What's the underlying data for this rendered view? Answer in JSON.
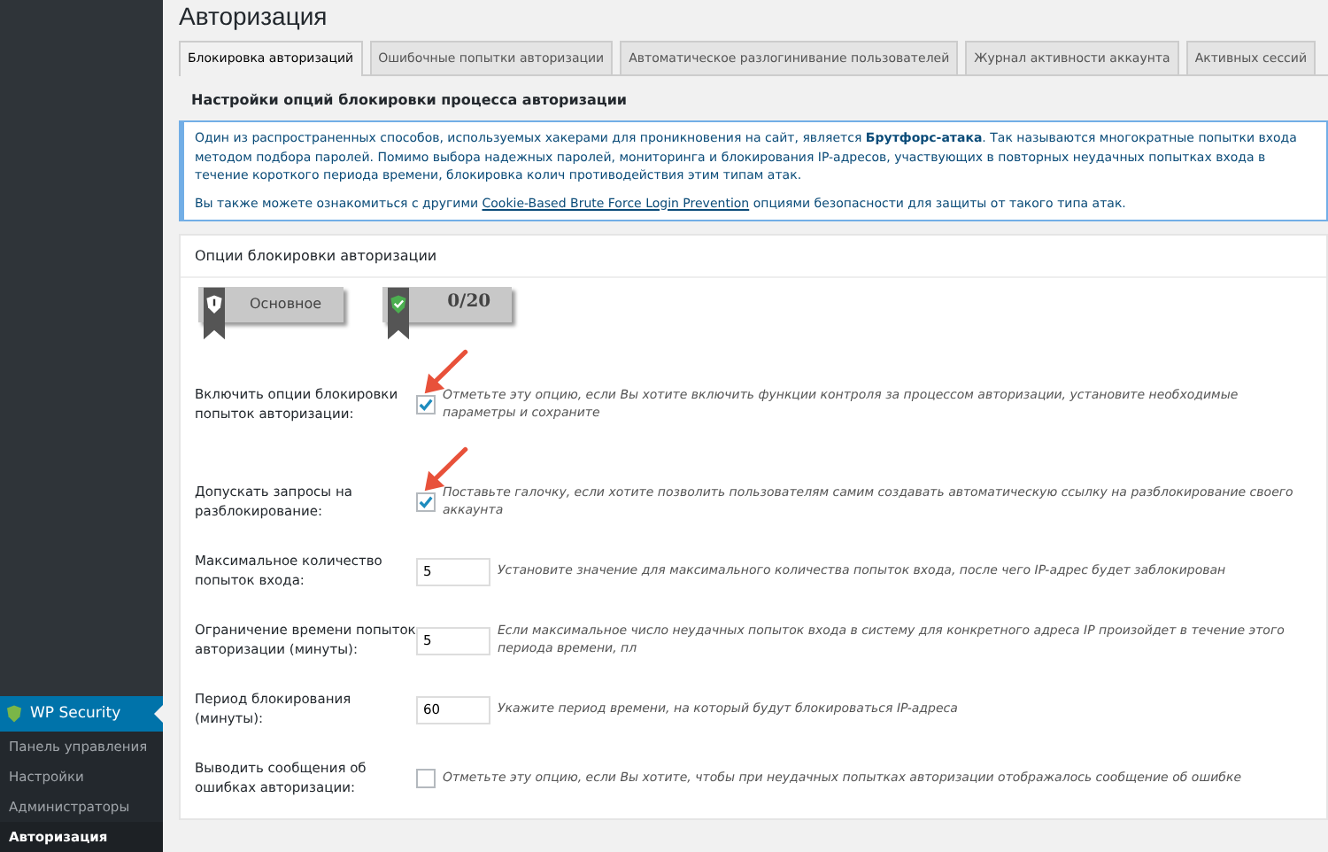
{
  "sidebar": {
    "items": [
      {
        "label": "WP Security",
        "kind": "header",
        "selected": true
      },
      {
        "label": "Панель управления",
        "kind": "item",
        "selected": false
      },
      {
        "label": "Настройки",
        "kind": "item",
        "selected": false
      },
      {
        "label": "Администраторы",
        "kind": "item",
        "selected": false
      },
      {
        "label": "Авторизация",
        "kind": "item",
        "selected": true
      }
    ]
  },
  "page": {
    "title": "Авторизация"
  },
  "tabs": [
    {
      "label": "Блокировка авторизаций",
      "selected": true
    },
    {
      "label": "Ошибочные попытки авторизации",
      "selected": false
    },
    {
      "label": "Автоматическое разлогинивание пользователей",
      "selected": false
    },
    {
      "label": "Журнал активности аккаунта",
      "selected": false
    },
    {
      "label": "Активных сессий",
      "selected": false
    }
  ],
  "subheading": "Настройки опций блокировки процесса авторизации",
  "info": {
    "paragraph": "Один из распространенных способов, используемых хакерами для проникновения на сайт, является **Брутфорс-атака**. Так называются многократные попытки входа методом подбора паролей. Помимо выбора надежных паролей, мониторинга и блокирования IP-адресов, участвующих в повторных неудачных попытках входа в течение короткого периода времени, блокировка колич противодействия этим типам атак.",
    "link_before": "Вы также можете ознакомиться с другими",
    "link": "Cookie-Based Brute Force Login Prevention",
    "link_after": "опциями безопасности для защиты от такого типа атак."
  },
  "options": {
    "title": "Опции блокировки авторизации",
    "badges": [
      {
        "label": "Основное",
        "kind": "warning"
      },
      {
        "label": "0/20",
        "kind": "ok"
      }
    ],
    "rows": [
      {
        "label": "Включить опции блокировки попыток авторизации:",
        "kind": "checkbox",
        "checked": true,
        "highlighted": true,
        "description": "Отметьте эту опцию, если Вы хотите включить функции контроля за процессом авторизации, установите необходимые параметры и сохраните"
      },
      {
        "label": "Допускать запросы на разблокирование:",
        "kind": "checkbox",
        "checked": true,
        "highlighted": true,
        "description": "Поставьте галочку, если хотите позволить пользователям самим создавать автоматическую ссылку на разблокирование своего аккаунта"
      },
      {
        "label": "Максимальное количество попыток входа:",
        "kind": "number",
        "value": "5",
        "description": "Установите значение для максимального количества попыток входа, после чего IP-адрес будет заблокирован"
      },
      {
        "label": "Ограничение времени попыток авторизации (минуты):",
        "kind": "number",
        "value": "5",
        "description": "Если максимальное число неудачных попыток входа в систему для конкретного адреса IP произойдет в течение этого периода времени, пл"
      },
      {
        "label": "Период блокирования (минуты):",
        "kind": "number",
        "value": "60",
        "description": "Укажите период времени, на который будут блокироваться IP-адреса"
      },
      {
        "label": "Выводить сообщения об ошибках авторизации:",
        "kind": "checkbox",
        "checked": false,
        "description": "Отметьте эту опцию, если Вы хотите, чтобы при неудачных попытках авторизации отображалось сообщение об ошибке"
      }
    ]
  }
}
